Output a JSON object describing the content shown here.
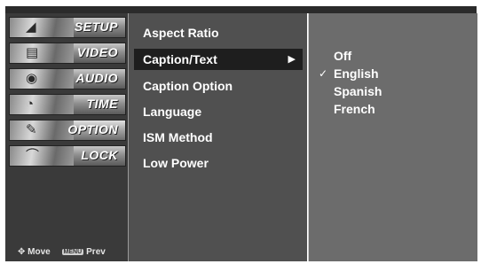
{
  "left_menu": {
    "categories": [
      {
        "label": "SETUP",
        "icon": "satellite-dish-icon"
      },
      {
        "label": "VIDEO",
        "icon": "film-icon"
      },
      {
        "label": "AUDIO",
        "icon": "speaker-icon"
      },
      {
        "label": "TIME",
        "icon": "clock-icon"
      },
      {
        "label": "OPTION",
        "icon": "option-icon"
      },
      {
        "label": "LOCK",
        "icon": "lock-icon"
      }
    ],
    "active_index": 4,
    "nav_hints": {
      "move": "Move",
      "menu_key": "MENU",
      "prev": "Prev"
    }
  },
  "option_menu": {
    "items": [
      "Aspect Ratio",
      "Caption/Text",
      "Caption Option",
      "Language",
      "ISM Method",
      "Low Power"
    ],
    "selected_index": 1
  },
  "submenu": {
    "options": [
      "Off",
      "English",
      "Spanish",
      "French"
    ],
    "checked_index": 1
  },
  "colors": {
    "left_panel": "#3a3a3a",
    "middle_panel": "#505050",
    "right_panel": "#6c6c6c",
    "selection": "#1e1e1e",
    "text": "#ffffff"
  }
}
